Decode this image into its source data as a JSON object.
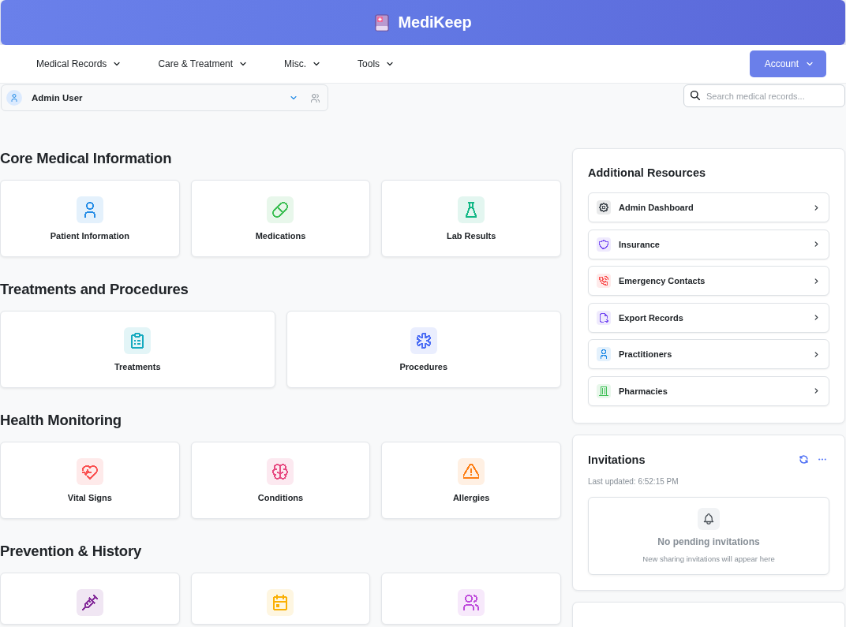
{
  "header": {
    "title": "MediKeep"
  },
  "nav": {
    "items": [
      {
        "label": "Medical Records"
      },
      {
        "label": "Care & Treatment"
      },
      {
        "label": "Misc."
      },
      {
        "label": "Tools"
      }
    ],
    "account": {
      "label": "Account"
    }
  },
  "user_bar": {
    "user_name": "Admin User"
  },
  "search": {
    "placeholder": "Search medical records..."
  },
  "sections": [
    {
      "title": "Core Medical Information",
      "cards": [
        {
          "label": "Patient Information",
          "kind": "person",
          "color": "#228be6"
        },
        {
          "label": "Medications",
          "kind": "pill",
          "color": "#40c057"
        },
        {
          "label": "Lab Results",
          "kind": "flask",
          "color": "#12b886"
        }
      ]
    },
    {
      "title": "Treatments and Procedures",
      "cards": [
        {
          "label": "Treatments",
          "kind": "clipboard",
          "color": "#15aabf"
        },
        {
          "label": "Procedures",
          "kind": "asterisk",
          "color": "#4c6ef5"
        }
      ]
    },
    {
      "title": "Health Monitoring",
      "cards": [
        {
          "label": "Vital Signs",
          "kind": "heartbeat",
          "color": "#fa5252"
        },
        {
          "label": "Conditions",
          "kind": "brain",
          "color": "#e64980"
        },
        {
          "label": "Allergies",
          "kind": "warning",
          "color": "#fd7e14"
        }
      ]
    },
    {
      "title": "Prevention & History",
      "cards": [
        {
          "kind": "syringe",
          "color": "#862e9c"
        },
        {
          "kind": "calendar",
          "color": "#fab005"
        },
        {
          "kind": "people",
          "color": "#be4bdb"
        }
      ]
    }
  ],
  "resources": {
    "title": "Additional Resources",
    "items": [
      {
        "label": "Admin Dashboard",
        "kind": "gear",
        "color": "#495057"
      },
      {
        "label": "Insurance",
        "kind": "shield",
        "color": "#7950f2"
      },
      {
        "label": "Emergency Contacts",
        "kind": "phone",
        "color": "#fa5252"
      },
      {
        "label": "Export Records",
        "kind": "document",
        "color": "#7950f2"
      },
      {
        "label": "Practitioners",
        "kind": "person",
        "color": "#228be6"
      },
      {
        "label": "Pharmacies",
        "kind": "building",
        "color": "#40c057"
      }
    ]
  },
  "invitations": {
    "title": "Invitations",
    "last_updated": "Last updated: 6:52:15 PM",
    "empty_title": "No pending invitations",
    "empty_text": "New sharing invitations will appear here"
  }
}
